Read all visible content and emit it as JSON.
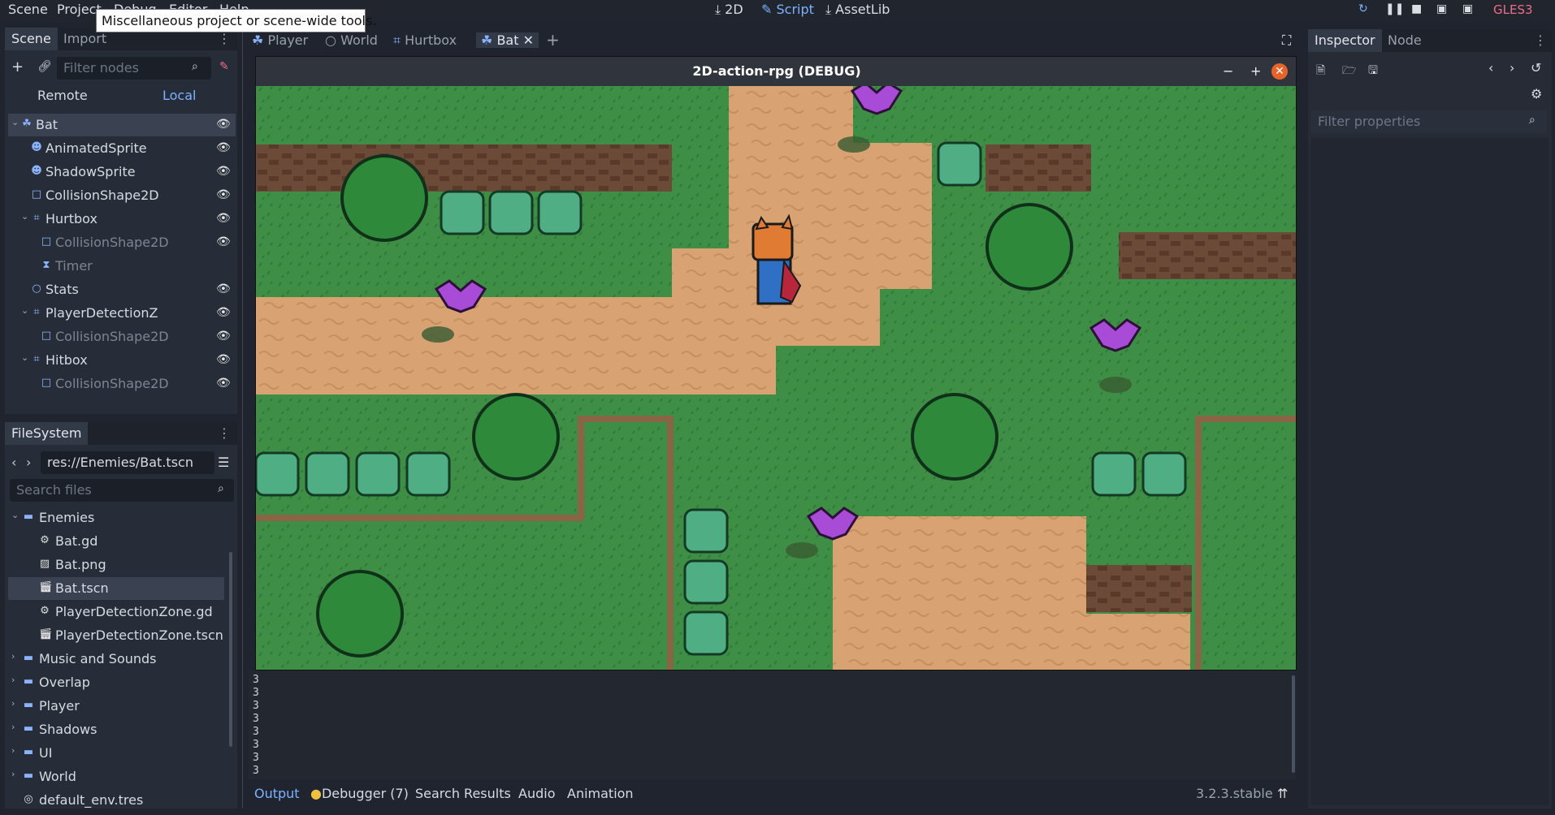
{
  "menu": [
    "Scene",
    "Project",
    "Debug",
    "Editor",
    "Help"
  ],
  "tooltip": "Miscellaneous project or scene-wide tools.",
  "workspaces": [
    "2D",
    "Script",
    "AssetLib"
  ],
  "renderer": "GLES3",
  "scene_dock": {
    "tabs": [
      "Scene",
      "Import"
    ],
    "filter_placeholder": "Filter nodes",
    "remote": "Remote",
    "local": "Local",
    "nodes": [
      {
        "label": "Bat",
        "level": 0,
        "icon": "kinematic-body-icon",
        "muted": false
      },
      {
        "label": "AnimatedSprite",
        "level": 1,
        "icon": "sprite-icon",
        "muted": false
      },
      {
        "label": "ShadowSprite",
        "level": 1,
        "icon": "sprite-icon",
        "muted": false
      },
      {
        "label": "CollisionShape2D",
        "level": 1,
        "icon": "collision-shape-icon",
        "muted": false
      },
      {
        "label": "Hurtbox",
        "level": 1,
        "icon": "area-icon",
        "muted": false
      },
      {
        "label": "CollisionShape2D",
        "level": 2,
        "icon": "collision-shape-icon",
        "muted": true
      },
      {
        "label": "Timer",
        "level": 2,
        "icon": "timer-icon",
        "muted": true
      },
      {
        "label": "Stats",
        "level": 1,
        "icon": "node-icon",
        "muted": false
      },
      {
        "label": "PlayerDetectionZ",
        "level": 1,
        "icon": "area-icon",
        "muted": false
      },
      {
        "label": "CollisionShape2D",
        "level": 2,
        "icon": "collision-shape-icon",
        "muted": true
      },
      {
        "label": "Hitbox",
        "level": 1,
        "icon": "area-icon",
        "muted": false
      },
      {
        "label": "CollisionShape2D",
        "level": 2,
        "icon": "collision-shape-icon",
        "muted": true
      }
    ]
  },
  "filesystem": {
    "tab": "FileSystem",
    "path": "res://Enemies/Bat.tscn",
    "search_placeholder": "Search files",
    "items": [
      {
        "label": "Enemies",
        "folder": true,
        "level": 0
      },
      {
        "label": "Bat.gd",
        "folder": false,
        "level": 1,
        "icon": "gear-icon"
      },
      {
        "label": "Bat.png",
        "folder": false,
        "level": 1,
        "icon": "image-icon"
      },
      {
        "label": "Bat.tscn",
        "folder": false,
        "level": 1,
        "icon": "scene-icon"
      },
      {
        "label": "PlayerDetectionZone.gd",
        "folder": false,
        "level": 1,
        "icon": "gear-icon"
      },
      {
        "label": "PlayerDetectionZone.tscn",
        "folder": false,
        "level": 1,
        "icon": "scene-icon"
      },
      {
        "label": "Music and Sounds",
        "folder": true,
        "level": 0
      },
      {
        "label": "Overlap",
        "folder": true,
        "level": 0
      },
      {
        "label": "Player",
        "folder": true,
        "level": 0
      },
      {
        "label": "Shadows",
        "folder": true,
        "level": 0
      },
      {
        "label": "UI",
        "folder": true,
        "level": 0
      },
      {
        "label": "World",
        "folder": true,
        "level": 0
      },
      {
        "label": "default_env.tres",
        "folder": false,
        "level": 0,
        "icon": "resource-icon"
      }
    ]
  },
  "editor_tabs": [
    "Player",
    "World",
    "Hurtbox",
    "Bat"
  ],
  "game_window": {
    "title": "2D-action-rpg (DEBUG)"
  },
  "output_lines": [
    "3",
    "3",
    "3",
    "3",
    "3",
    "3",
    "3",
    "3"
  ],
  "bottom_tabs": [
    "Output",
    "Debugger (7)",
    "Search Results",
    "Audio",
    "Animation"
  ],
  "version": "3.2.3.stable",
  "inspector": {
    "tabs": [
      "Inspector",
      "Node"
    ],
    "filter_placeholder": "Filter properties"
  },
  "colors": {
    "accent": "#7cb2ff",
    "renderer": "#ee6d87",
    "grass": "#3e8f45",
    "dirt": "#d8a272",
    "cliff": "#6b4a37"
  }
}
